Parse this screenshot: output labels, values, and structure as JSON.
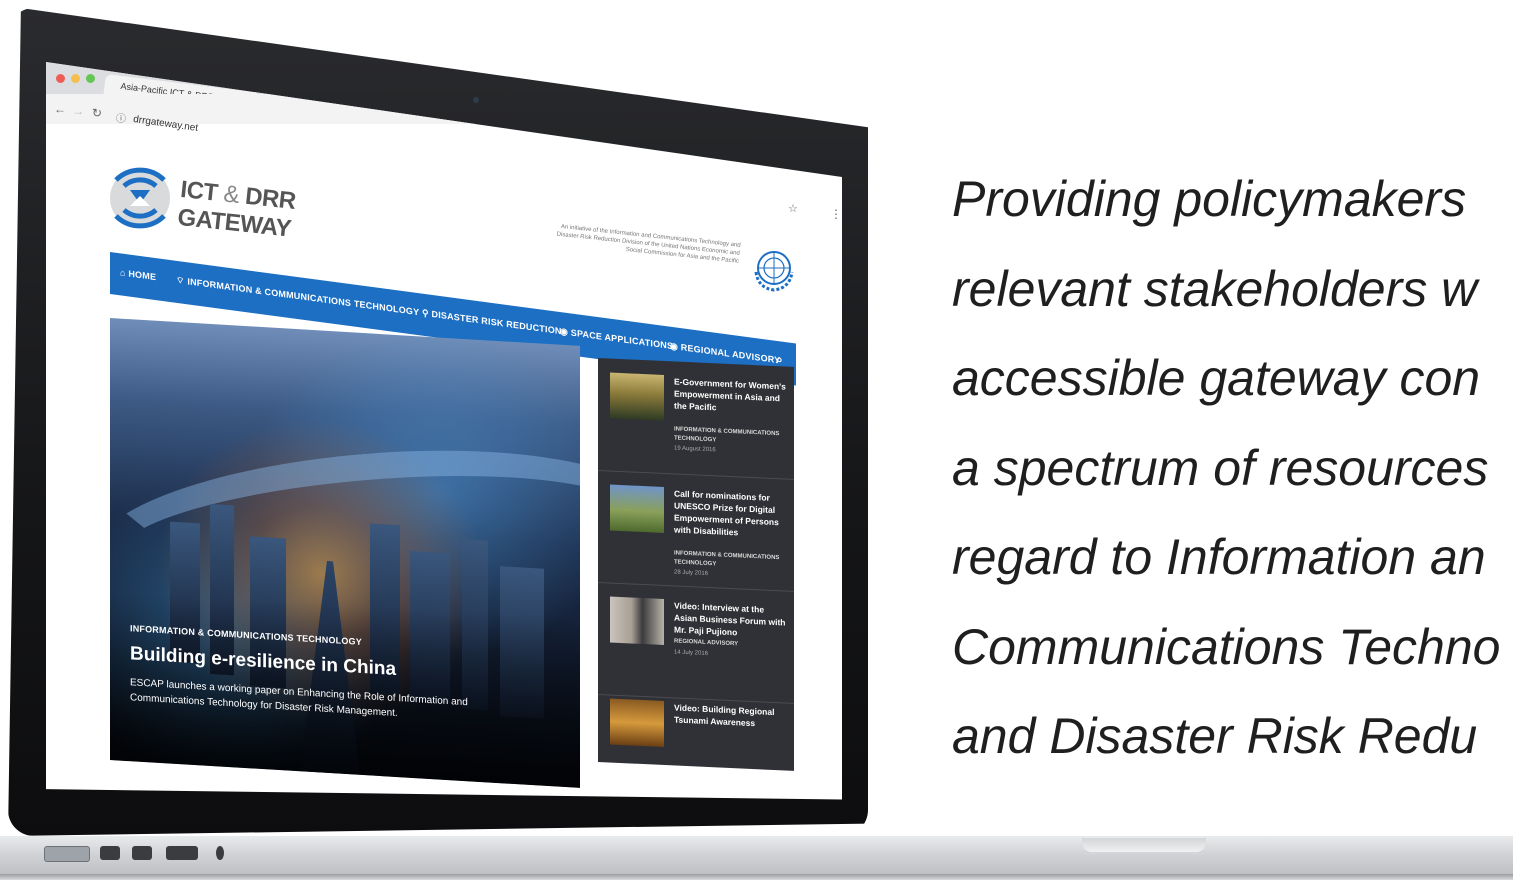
{
  "browser": {
    "tab_title": "Asia-Pacific ICT & DRR Gatew",
    "tab_close": "×",
    "url": "drrgateway.net"
  },
  "site": {
    "title_line1_a": "ICT ",
    "title_amp": "&",
    "title_line1_b": " DRR",
    "title_line2": "GATEWAY",
    "tagline": "An initiative of the Information and Communications Technology and Disaster Risk Reduction Division of the United Nations Economic and Social Commission for Asia and the Pacific"
  },
  "nav": {
    "home": "HOME",
    "ict": "INFORMATION & COMMUNICATIONS TECHNOLOGY",
    "drr": "DISASTER RISK REDUCTION",
    "space": "SPACE APPLICATIONS",
    "regional": "REGIONAL ADVISORY"
  },
  "hero": {
    "category": "INFORMATION & COMMUNICATIONS TECHNOLOGY",
    "headline": "Building e-resilience in China",
    "summary": "ESCAP launches a working paper on Enhancing the Role of Information and Communications Technology for Disaster Risk Management."
  },
  "news": [
    {
      "title": "E-Government for Women's Empowerment in Asia and the Pacific",
      "category": "INFORMATION & COMMUNICATIONS TECHNOLOGY",
      "date": "19 August 2016"
    },
    {
      "title": "Call for nominations for UNESCO Prize for Digital Empowerment of Persons with Disabilities",
      "category": "INFORMATION & COMMUNICATIONS TECHNOLOGY",
      "date": "28 July 2016"
    },
    {
      "title": "Video: Interview at the Asian Business Forum with Mr. Paji Pujiono",
      "category": "REGIONAL ADVISORY",
      "date": "14 July 2016"
    },
    {
      "title": "Video: Building Regional Tsunami Awareness",
      "category": "",
      "date": ""
    }
  ],
  "copy": {
    "lines": [
      "Providing policymakers",
      "relevant stakeholders w",
      "accessible gateway con",
      "a spectrum of resources",
      "regard to Information an",
      "Communications Techno",
      "and Disaster Risk Redu"
    ]
  },
  "colors": {
    "nav_blue": "#1d6fc4",
    "sidebar_dark": "#2f3136",
    "copy_text": "#1f1f1f"
  }
}
